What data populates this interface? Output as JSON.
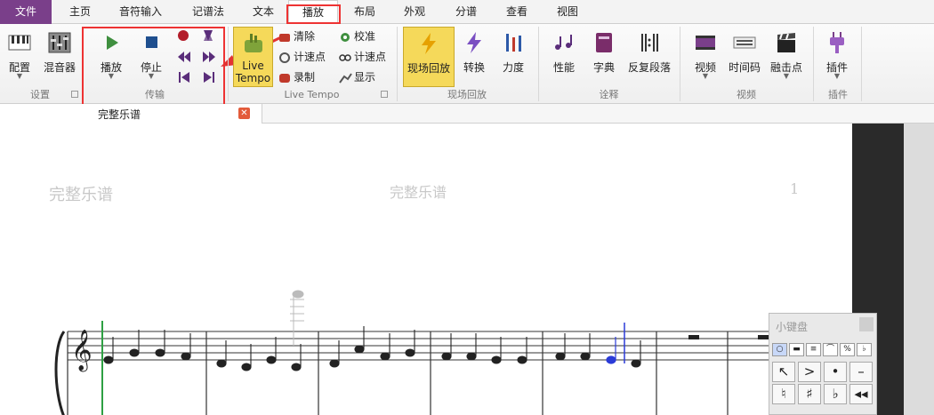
{
  "tabs": [
    {
      "label": "文件"
    },
    {
      "label": "主页"
    },
    {
      "label": "音符输入"
    },
    {
      "label": "记谱法"
    },
    {
      "label": "文本"
    },
    {
      "label": "播放"
    },
    {
      "label": "布局"
    },
    {
      "label": "外观"
    },
    {
      "label": "分谱"
    },
    {
      "label": "查看"
    },
    {
      "label": "视图"
    }
  ],
  "active_tab": "播放",
  "ribbon": {
    "setup": {
      "label": "设置",
      "config": "配置",
      "mixer": "混音器"
    },
    "transport": {
      "label": "传输",
      "play": "播放",
      "stop": "停止"
    },
    "live_tempo": {
      "label": "Live Tempo",
      "button": "Live Tempo",
      "clear": "清除",
      "tap_points": "计速点",
      "record": "录制",
      "calibrate": "校准",
      "tap_points2": "计速点",
      "show": "显示"
    },
    "live_playback": {
      "label": "现场回放",
      "live": "现场回放",
      "transform": "转换",
      "dynamics": "力度"
    },
    "interpretation": {
      "label": "诠释",
      "performance": "性能",
      "dictionary": "字典",
      "repeats": "反复段落"
    },
    "video": {
      "label": "视频",
      "video": "视频",
      "timecode": "时间码",
      "hitpoints": "融击点"
    },
    "plugins": {
      "label": "插件",
      "plugins": "插件"
    }
  },
  "document": {
    "tab_label": "完整乐谱"
  },
  "score": {
    "header_left": "完整乐谱",
    "header_center": "完整乐谱",
    "page_number": "1"
  },
  "keypad": {
    "title": "小键盘"
  },
  "colors": {
    "accent": "#7a3f8a",
    "highlight": "#e33333",
    "live_tempo": "#f5d95a",
    "playback_line": "#2ea043",
    "selected_note": "#2a3bd8"
  }
}
